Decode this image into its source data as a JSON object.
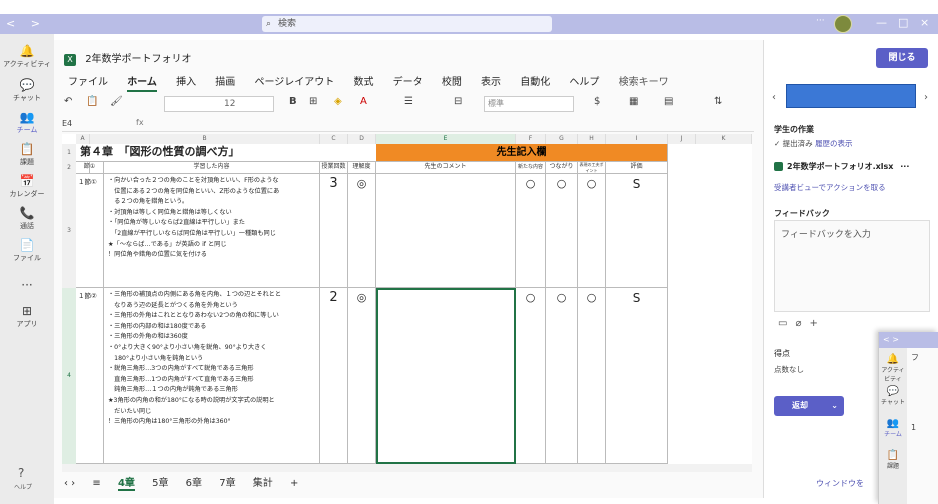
{
  "topbar": {
    "nav": "< >",
    "search_placeholder": "検索",
    "more": "···",
    "minimize": "—",
    "maximize": "□",
    "close": "×"
  },
  "rail": [
    {
      "icon": "bell-icon",
      "glyph": "🔔",
      "label": "アクティビティ"
    },
    {
      "icon": "chat-icon",
      "glyph": "💬",
      "label": "チャット"
    },
    {
      "icon": "teams-icon",
      "glyph": "👥",
      "label": "チーム",
      "active": true
    },
    {
      "icon": "assignments-icon",
      "glyph": "📋",
      "label": "課題"
    },
    {
      "icon": "calendar-icon",
      "glyph": "📅",
      "label": "カレンダー"
    },
    {
      "icon": "calls-icon",
      "glyph": "📞",
      "label": "通話"
    },
    {
      "icon": "files-icon",
      "glyph": "📄",
      "label": "ファイル"
    },
    {
      "icon": "more-apps-icon",
      "glyph": "···",
      "label": ""
    },
    {
      "icon": "apps-icon",
      "glyph": "⊞",
      "label": "アプリ"
    }
  ],
  "help_label": "ヘルプ",
  "excel": {
    "doc_title": "2年数学ポートフォリオ",
    "menu": [
      "ファイル",
      "ホーム",
      "挿入",
      "描画",
      "ページレイアウト",
      "数式",
      "データ",
      "校閲",
      "表示",
      "自動化",
      "ヘルプ"
    ],
    "tellme": "検索キーワ",
    "font_size": "12",
    "number_format": "標準",
    "cell_ref": "E4",
    "fx": "fx",
    "columns": [
      "A",
      "B",
      "C",
      "D",
      "E",
      "F",
      "G",
      "H",
      "I",
      "J",
      "K"
    ],
    "chapter_title": "第４章　「図形の性質の調べ方」",
    "teacher_header": "先生記入欄",
    "headers": {
      "lesson": "節①",
      "learned": "学習した内容",
      "hours": "授業回数",
      "understanding": "理解度",
      "comment": "先生のコメント",
      "new": "新たな内容",
      "connect": "つながり",
      "point": "表現の工夫ポイント",
      "eval": "評価"
    },
    "rows": [
      {
        "row_num": "3",
        "lesson": "１節①",
        "lines": [
          "・向かい合った２つの角のことを対頂角といい、F形のような",
          "　位置にある２つの角を同位角といい、Z形のような位置にあ",
          "　る２つの角を錯角という。",
          "・対頂角は等しく同位角と錯角は等しくない",
          "・「同位角が等しいならば2直線は平行しい」また",
          "　「2直線が平行しいならば同位角は平行しい」一種類も同じ",
          "★「〜ならば…である」が英語の if と同じ",
          "！同位角や錯角の位置に気を付ける"
        ],
        "hours": "3",
        "understanding": "◎",
        "new": "○",
        "connect": "○",
        "point": "○",
        "eval": "S"
      },
      {
        "row_num": "4",
        "lesson": "１節②",
        "lines": [
          "・三角形の補頂点の内側にある角を内角、１つの辺とそれとと",
          "　なりあう辺の延長とがつくる角を外角という",
          "・三角形の外角はこれととなりあわない2つの角の和に等しい",
          "・三角形の内部の和は180度である",
          "・三角形の外角の和は360度",
          "・0°より大きく90°より小さい角を鋭角、90°より大きく",
          "　180°より小さい角を鈍角という",
          "・鋭角三角形…3つの内角がすべて鋭角である三角形",
          "　直角三角形…1つの内角がすべて直角である三角形",
          "　鈍角三角形…１つの内角が鈍角である三角形",
          "★3角形の内角の和が180°になる時の説明が文字式の説明と",
          "　だいたい同じ",
          "！三角形の内角は180°三角形の外角は360°"
        ],
        "hours": "2",
        "understanding": "◎",
        "new": "○",
        "connect": "○",
        "point": "○",
        "eval": "S"
      }
    ],
    "sheet_tabs": [
      "≡",
      "4章",
      "5章",
      "6章",
      "7章",
      "集計",
      "+"
    ]
  },
  "panel": {
    "close_button": "閉じる",
    "student_work_label": "学生の作業",
    "submitted": "✓ 提出済み",
    "history": "履歴の表示",
    "file_name": "2年数学ポートフォリオ.xlsx",
    "file_more": "···",
    "action_link": "受講者ビューでアクションを取る",
    "feedback_label": "フィードバック",
    "feedback_placeholder": "フィードバックを入力",
    "points_label": "得点",
    "points_value": "点数なし",
    "return_button": "返却",
    "window_link": "ウィンドウを"
  },
  "win2": {
    "nav": "< >",
    "content_text": "フ",
    "row_number": "1",
    "rail": [
      {
        "icon": "bell-icon",
        "glyph": "🔔",
        "label": "アクティビティ"
      },
      {
        "icon": "chat-icon",
        "glyph": "💬",
        "label": "チャット"
      },
      {
        "icon": "teams-icon",
        "glyph": "👥",
        "label": "チーム",
        "active": true
      },
      {
        "icon": "assignments-icon",
        "glyph": "📋",
        "label": "課題"
      }
    ]
  },
  "colors": {
    "accent": "#5b5fc7",
    "topbar": "#b9bde6",
    "teacher_header": "#f08a24",
    "excel_green": "#217346",
    "student_box": "#3b78d6"
  }
}
